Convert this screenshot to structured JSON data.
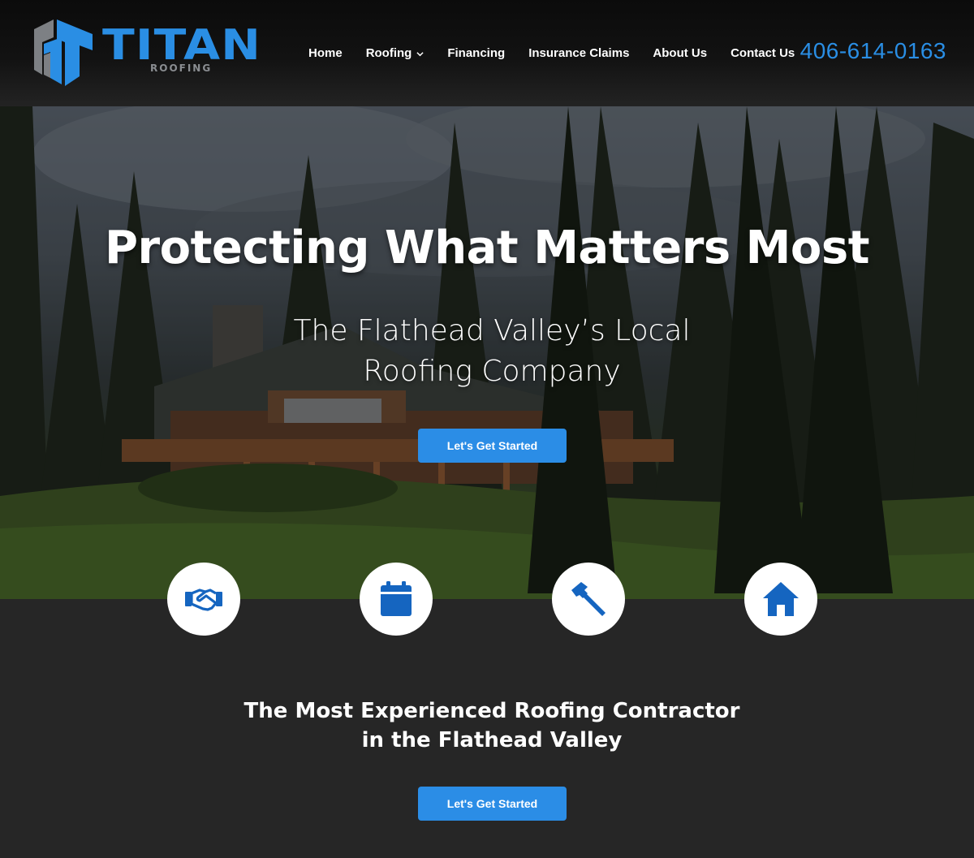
{
  "brand": {
    "name": "TITAN",
    "tagline": "ROOFING",
    "primary_color": "#2a8ee4",
    "secondary_color": "#8a8d91"
  },
  "nav": {
    "items": [
      {
        "label": "Home"
      },
      {
        "label": "Roofing",
        "has_dropdown": true
      },
      {
        "label": "Financing"
      },
      {
        "label": "Insurance Claims"
      },
      {
        "label": "About Us"
      },
      {
        "label": "Contact Us"
      }
    ],
    "phone": "406-614-0163"
  },
  "hero": {
    "title": "Protecting What Matters Most",
    "subtitle": "The Flathead Valley’s Local Roofing Company",
    "cta_label": "Let's Get Started"
  },
  "features": [
    {
      "icon": "handshake-icon"
    },
    {
      "icon": "calendar-icon"
    },
    {
      "icon": "hammer-icon"
    },
    {
      "icon": "house-icon"
    }
  ],
  "section": {
    "title": "The Most Experienced Roofing Contractor in the Flathead Valley",
    "cta_label": "Let's Get Started"
  },
  "colors": {
    "button_bg": "#2b8de6",
    "page_bg": "#262626",
    "icon_color": "#1565c0"
  }
}
